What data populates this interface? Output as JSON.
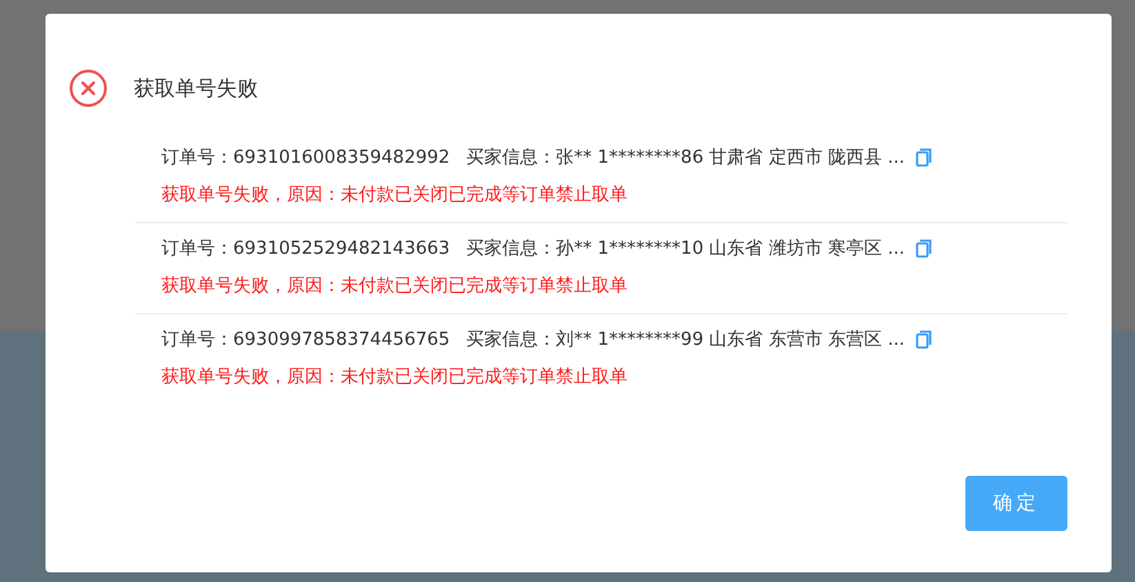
{
  "dialog": {
    "title": "获取单号失败",
    "orders": [
      {
        "order_no": "订单号：6931016008359482992",
        "buyer": "买家信息：张** 1********86 甘肃省 定西市 陇西县 ...",
        "error": "获取单号失败，原因：未付款已关闭已完成等订单禁止取单"
      },
      {
        "order_no": "订单号：6931052529482143663",
        "buyer": "买家信息：孙** 1********10 山东省 潍坊市 寒亭区 ...",
        "error": "获取单号失败，原因：未付款已关闭已完成等订单禁止取单"
      },
      {
        "order_no": "订单号：6930997858374456765",
        "buyer": "买家信息：刘** 1********99 山东省 东营市 东营区 ...",
        "error": "获取单号失败，原因：未付款已关闭已完成等订单禁止取单"
      }
    ],
    "buttons": [
      "确定"
    ]
  }
}
